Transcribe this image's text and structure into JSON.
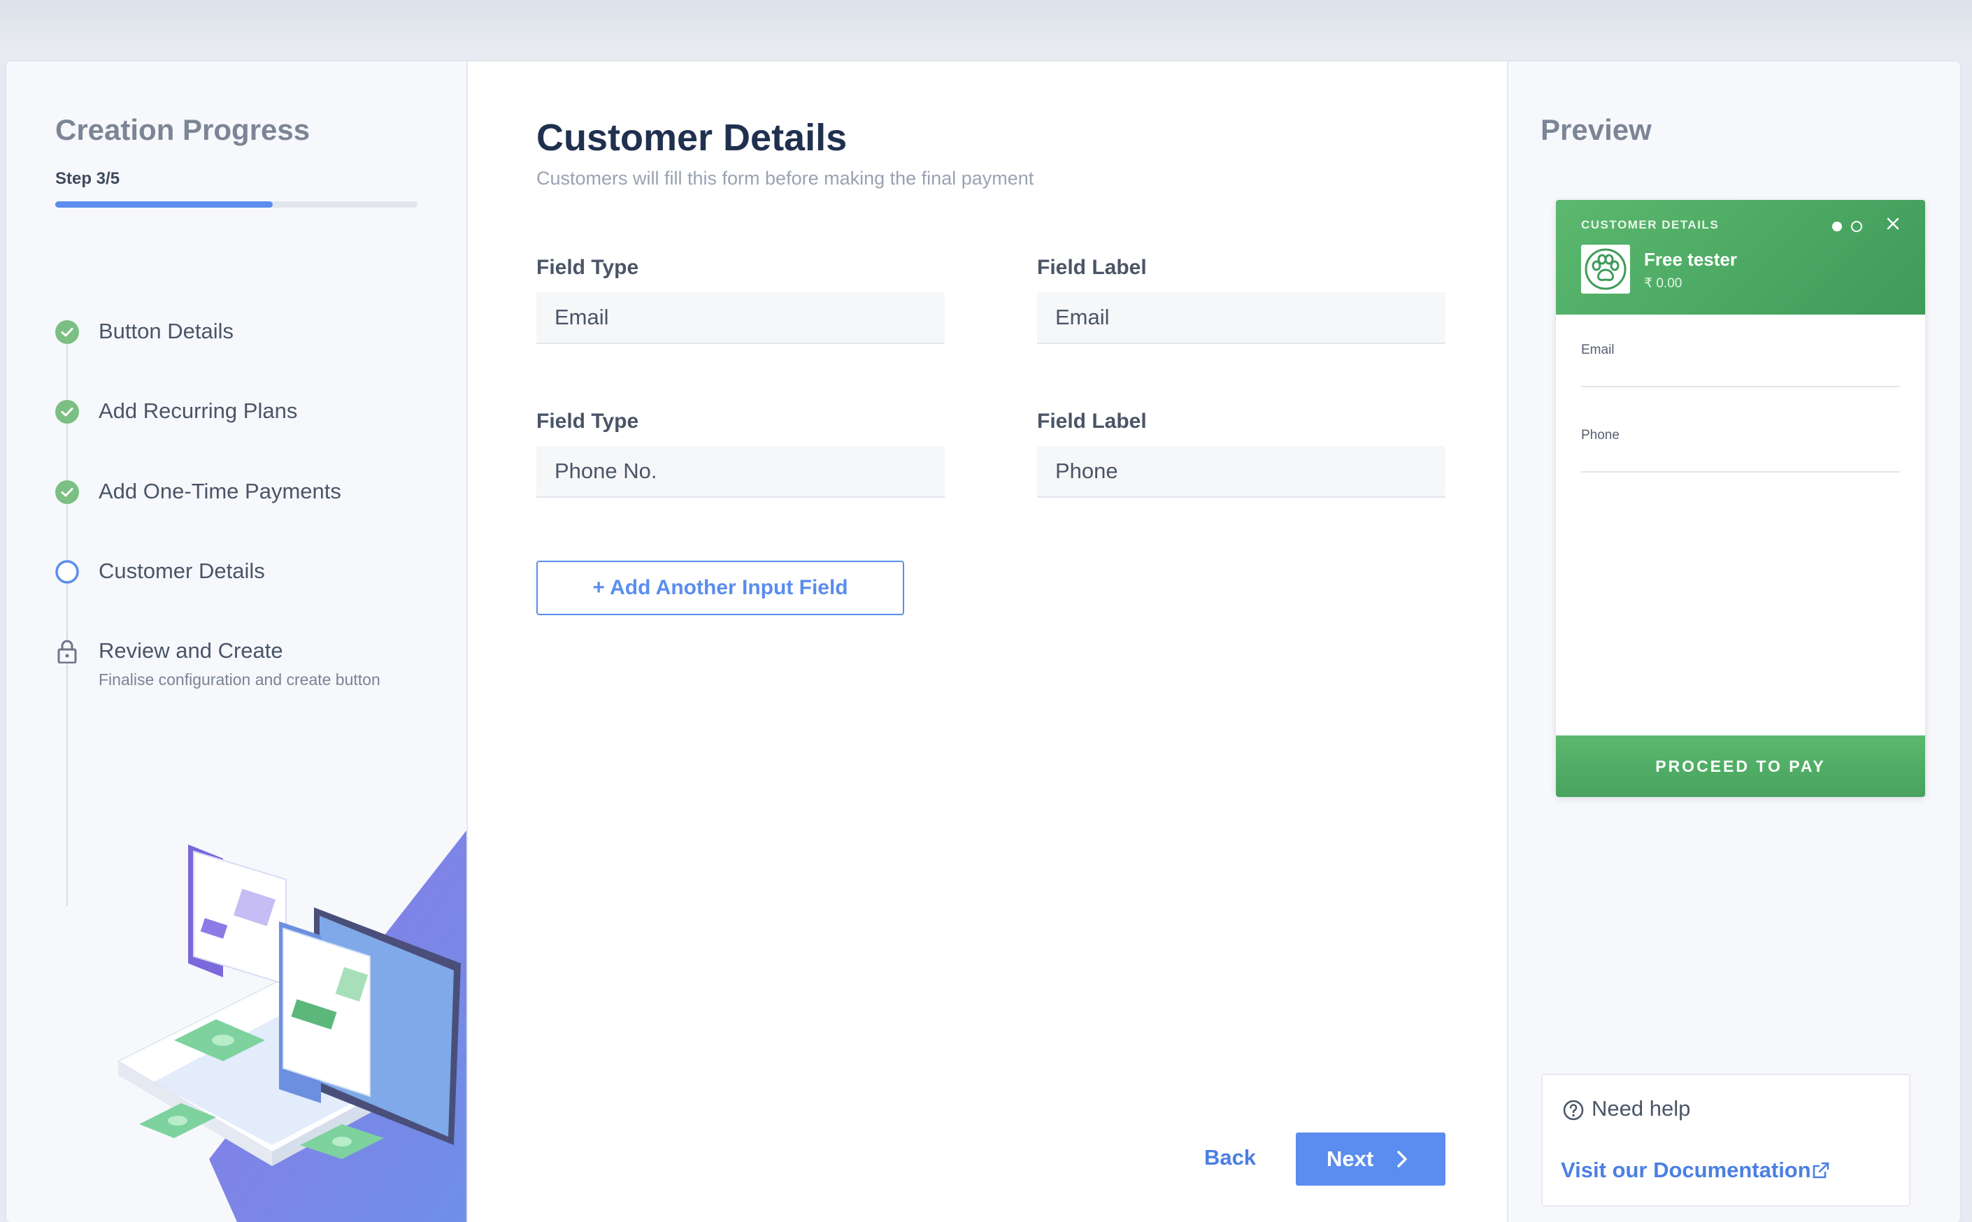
{
  "sidebar": {
    "title": "Creation Progress",
    "step_text": "Step 3/5",
    "progress_fraction": 0.6,
    "steps": [
      {
        "label": "Button Details",
        "status": "done",
        "icon": "check-circle-icon"
      },
      {
        "label": "Add Recurring Plans",
        "status": "done",
        "icon": "check-circle-icon"
      },
      {
        "label": "Add One-Time Payments",
        "status": "done",
        "icon": "check-circle-icon"
      },
      {
        "label": "Customer Details",
        "status": "current",
        "icon": "circle-outline-icon"
      },
      {
        "label": "Review and Create",
        "sub": "Finalise configuration and create button",
        "status": "locked",
        "icon": "lock-icon"
      }
    ]
  },
  "main": {
    "title": "Customer Details",
    "subtitle": "Customers will fill this form before making the final payment",
    "fields": [
      {
        "type_label": "Field Type",
        "type_value": "Email",
        "label_label": "Field Label",
        "label_value": "Email"
      },
      {
        "type_label": "Field Type",
        "type_value": "Phone No.",
        "label_label": "Field Label",
        "label_value": "Phone"
      }
    ],
    "add_field_button": "+ Add Another Input Field",
    "back_button": "Back",
    "next_button": "Next"
  },
  "preview": {
    "title": "Preview",
    "widget": {
      "caption": "CUSTOMER DETAILS",
      "name": "Free tester",
      "price": "₹ 0.00",
      "fields": [
        "Email",
        "Phone"
      ],
      "pay_button": "PROCEED TO PAY"
    },
    "help": {
      "title": "Need help",
      "link": "Visit our Documentation"
    }
  },
  "colors": {
    "accent": "#5a8def",
    "success": "#5cab67",
    "widget_green": "#4caf62"
  }
}
